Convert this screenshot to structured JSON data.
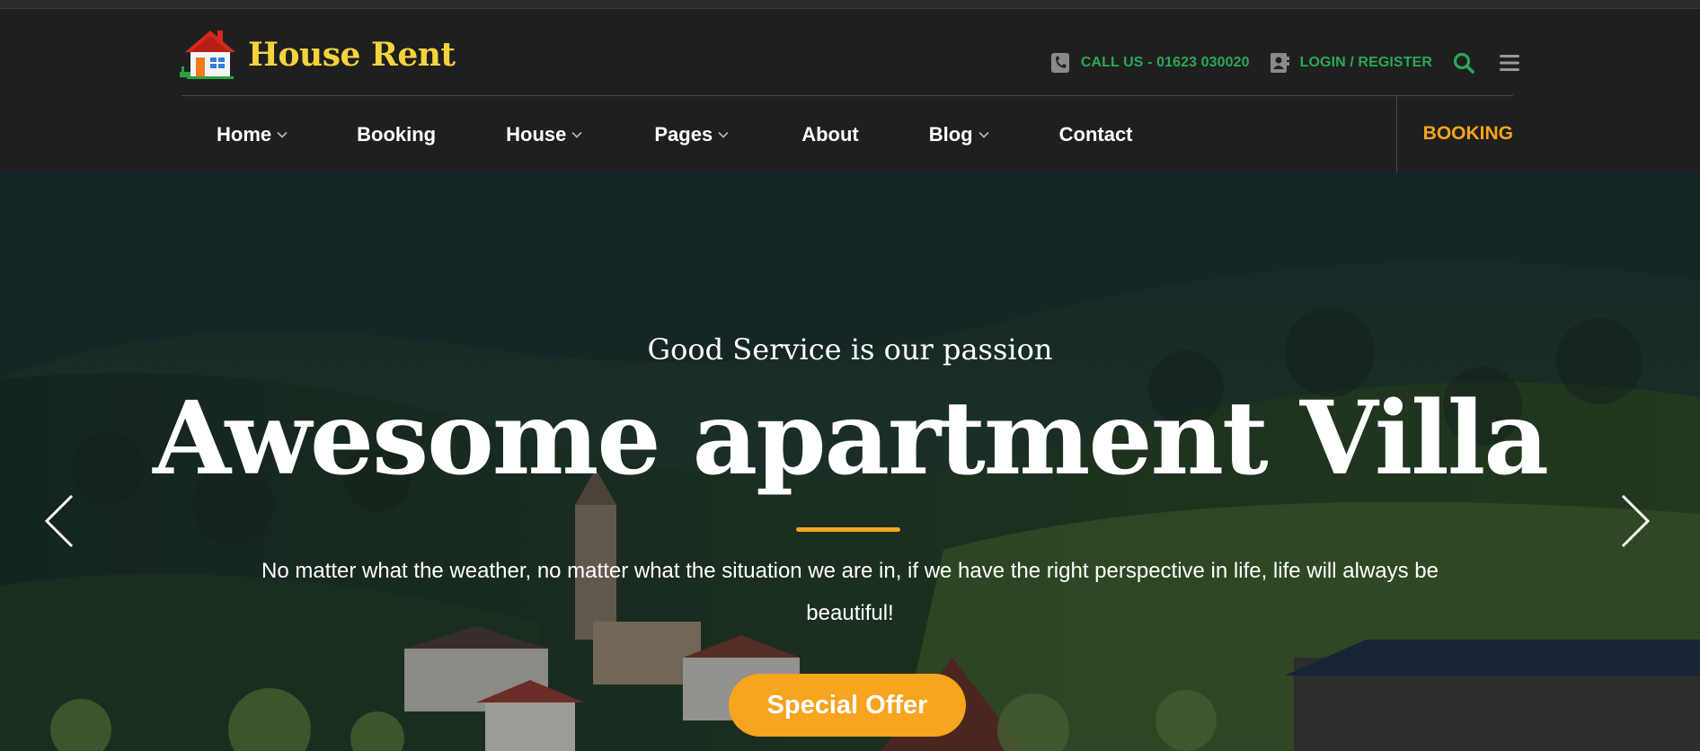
{
  "brand": {
    "name": "House Rent",
    "accent": "#f5d33b"
  },
  "colors": {
    "green": "#2ca75a",
    "orange": "#f7a41e",
    "header_bg": "#1f1f1f"
  },
  "topbar": {
    "call_icon": "phone-icon",
    "call_label": "CALL US - 01623 030020",
    "login_icon": "contact-book-icon",
    "login_label": "LOGIN / REGISTER",
    "search_icon": "search-icon",
    "menu_icon": "hamburger-menu-icon"
  },
  "nav": {
    "items": [
      {
        "label": "Home",
        "has_dropdown": true
      },
      {
        "label": "Booking",
        "has_dropdown": false
      },
      {
        "label": "House",
        "has_dropdown": true
      },
      {
        "label": "Pages",
        "has_dropdown": true
      },
      {
        "label": "About",
        "has_dropdown": false
      },
      {
        "label": "Blog",
        "has_dropdown": true
      },
      {
        "label": "Contact",
        "has_dropdown": false
      }
    ],
    "cta": "BOOKING"
  },
  "hero": {
    "subtitle": "Good Service is our passion",
    "title": "Awesome apartment Villa",
    "description": "No matter what the weather, no matter what the situation we are in, if we have the right perspective in life, life will always be beautiful!",
    "button": "Special Offer",
    "prev_icon": "chevron-left-icon",
    "next_icon": "chevron-right-icon"
  }
}
